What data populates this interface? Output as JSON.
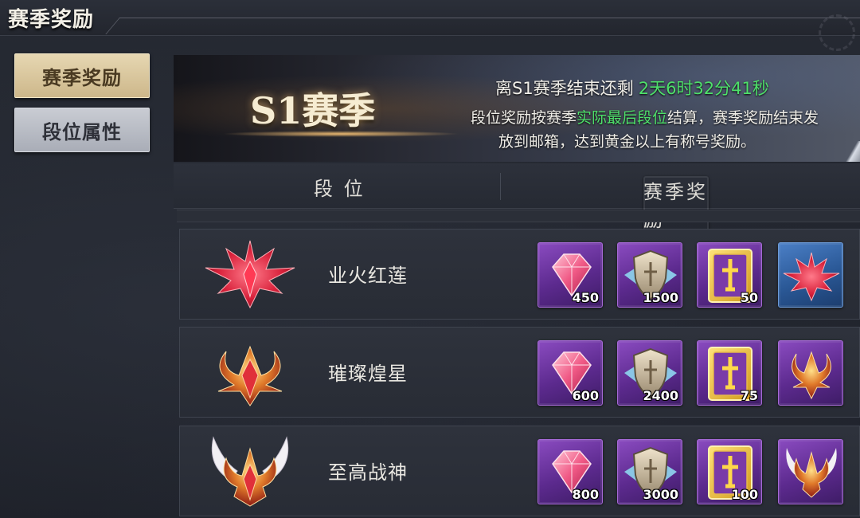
{
  "header": {
    "title": "赛季奖励"
  },
  "sidebar": {
    "items": [
      {
        "label": "赛季奖励",
        "active": true
      },
      {
        "label": "段位属性",
        "active": false
      }
    ]
  },
  "banner": {
    "season_title": "S1赛季",
    "countdown_prefix": "离S1赛季结束还剩",
    "countdown_time": "2天6时32分41秒",
    "desc_part1": "段位奖励按赛季",
    "desc_highlight": "实际最后段位",
    "desc_part2": "结算，赛季奖励结束发",
    "desc_line2": "放到邮箱，达到黄金以上有称号奖励。"
  },
  "table": {
    "col_rank": "段 位",
    "col_reward": "赛季奖励"
  },
  "rows": [
    {
      "rank_name": "业火红莲",
      "emblem_icon": "red-lotus-emblem-icon",
      "rewards": [
        {
          "icon": "gem-icon",
          "qty": "450"
        },
        {
          "icon": "shield-token-icon",
          "qty": "1500"
        },
        {
          "icon": "gold-card-icon",
          "qty": "50"
        },
        {
          "icon": "red-lotus-emblem-icon",
          "qty": ""
        }
      ]
    },
    {
      "rank_name": "璀璨煌星",
      "emblem_icon": "radiant-star-emblem-icon",
      "rewards": [
        {
          "icon": "gem-icon",
          "qty": "600"
        },
        {
          "icon": "shield-token-icon",
          "qty": "2400"
        },
        {
          "icon": "gold-card-icon",
          "qty": "75"
        },
        {
          "icon": "radiant-star-emblem-icon",
          "qty": ""
        }
      ]
    },
    {
      "rank_name": "至高战神",
      "emblem_icon": "supreme-war-god-emblem-icon",
      "rewards": [
        {
          "icon": "gem-icon",
          "qty": "800"
        },
        {
          "icon": "shield-token-icon",
          "qty": "3000"
        },
        {
          "icon": "gold-card-icon",
          "qty": "100"
        },
        {
          "icon": "supreme-war-god-emblem-icon",
          "qty": ""
        }
      ]
    }
  ],
  "colors": {
    "highlight": "#4ee06a",
    "active_tab": "#e6d7b2",
    "reward_purple": "#5c2a8e",
    "reward_blue": "#2a5896"
  }
}
